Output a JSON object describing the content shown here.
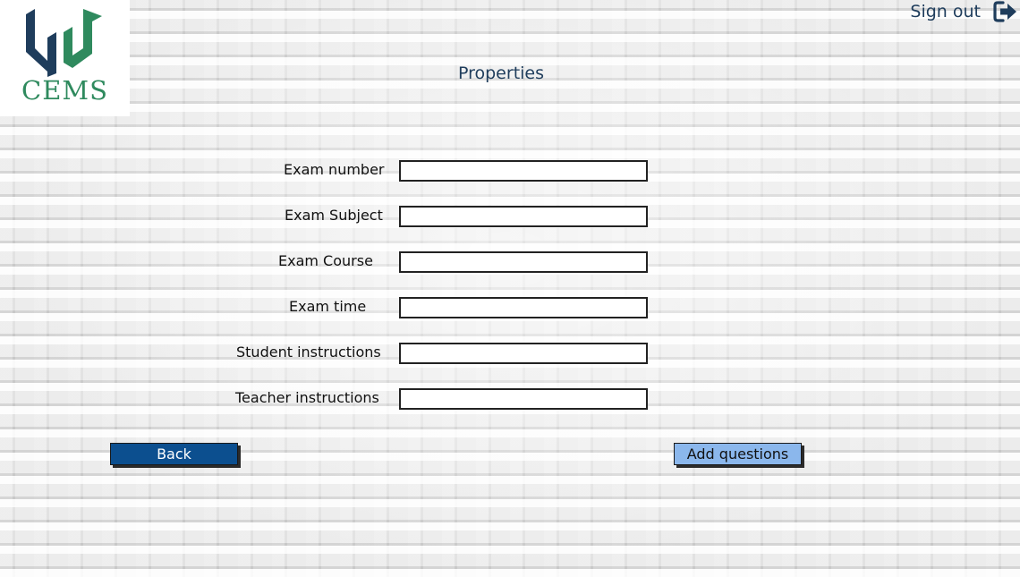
{
  "brand": {
    "name": "CEMS",
    "primary_color": "#1f3d5c",
    "accent_color": "#2f8a5e"
  },
  "header": {
    "sign_out_label": "Sign out",
    "sign_out_icon": "sign-out-icon"
  },
  "page": {
    "title": "Properties"
  },
  "form": {
    "fields": [
      {
        "label": "Exam number",
        "value": ""
      },
      {
        "label": "Exam Subject",
        "value": ""
      },
      {
        "label": "Exam Course",
        "value": ""
      },
      {
        "label": "Exam time",
        "value": ""
      },
      {
        "label": "Student instructions",
        "value": ""
      },
      {
        "label": "Teacher instructions",
        "value": ""
      }
    ]
  },
  "actions": {
    "back_label": "Back",
    "back_color": "#0c4f8f",
    "add_questions_label": "Add questions",
    "add_questions_color": "#8bb7ec"
  }
}
